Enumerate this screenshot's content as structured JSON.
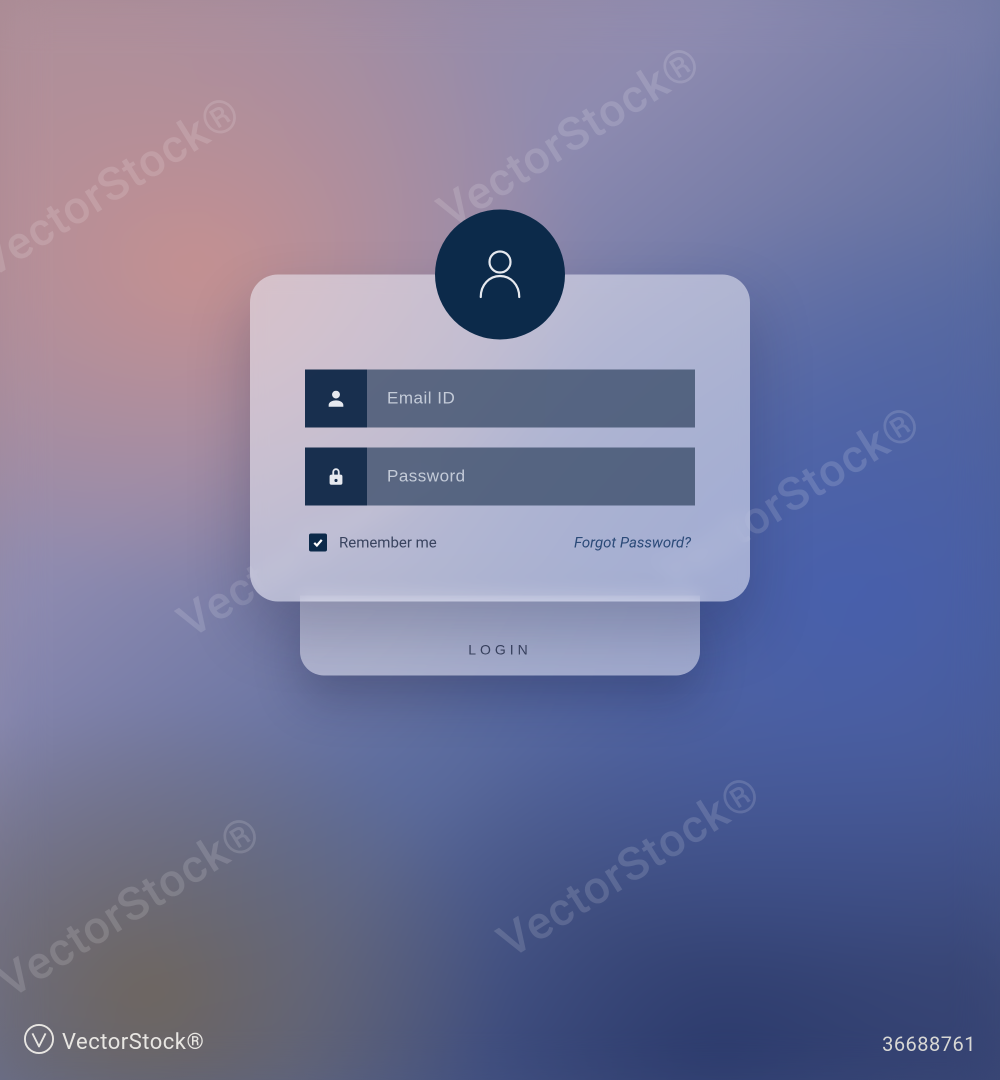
{
  "avatar": {
    "icon": "user-icon"
  },
  "form": {
    "email": {
      "placeholder": "Email ID",
      "value": "",
      "icon": "person-icon"
    },
    "password": {
      "placeholder": "Password",
      "value": "",
      "icon": "lock-icon"
    },
    "remember": {
      "label": "Remember me",
      "checked": true
    },
    "forgot_label": "Forgot Password?",
    "login_label": "LOGIN"
  },
  "watermark": {
    "diagonal_text": "VectorStock®",
    "brand": "VectorStock®",
    "id_text": "36688761"
  },
  "colors": {
    "avatar_bg": "#0c2a4a",
    "input_icon_bg": "#122a4a",
    "input_bg": "#3c4e6a",
    "card_bg": "rgba(235,235,245,0.55)"
  }
}
